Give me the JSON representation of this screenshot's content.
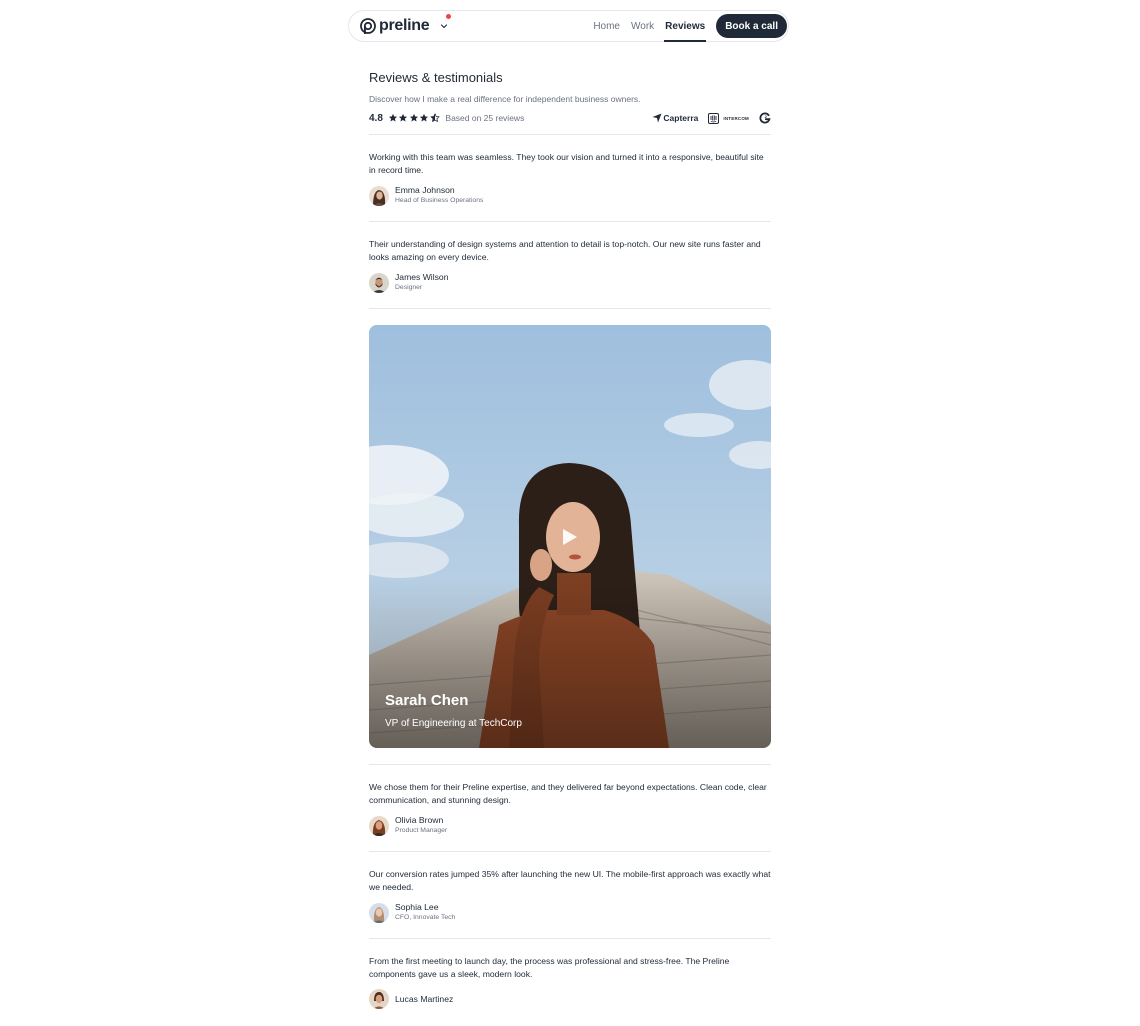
{
  "header": {
    "brand_name": "preline",
    "nav": [
      {
        "label": "Home",
        "active": false
      },
      {
        "label": "Work",
        "active": false
      },
      {
        "label": "Reviews",
        "active": true
      }
    ],
    "cta_label": "Book a call",
    "icons": {
      "logo": "preline-logo-icon",
      "chevron": "chevron-down-icon",
      "notification": "notification-dot"
    }
  },
  "section": {
    "title": "Reviews & testimonials",
    "subtitle": "Discover how I make a real difference for independent business owners.",
    "rating_value": "4.8",
    "stars_full": 4,
    "stars_half": 1,
    "rating_text": "Based on 25 reviews",
    "partners": [
      {
        "name": "Capterra",
        "icon": "capterra-icon"
      },
      {
        "name": "INTERCOM",
        "icon": "intercom-icon"
      },
      {
        "name": "G2",
        "icon": "g2-icon"
      }
    ]
  },
  "reviews_before": [
    {
      "quote": "Working with this team was seamless. They took our vision and turned it into a responsive, beautiful site in record time.",
      "name": "Emma Johnson",
      "role": "Head of Business Operations"
    },
    {
      "quote": "Their understanding of design systems and attention to detail is top-notch. Our new site runs faster and looks amazing on every device.",
      "name": "James Wilson",
      "role": "Designer"
    }
  ],
  "video": {
    "name": "Sarah Chen",
    "role": "VP of Engineering at TechCorp",
    "icon": "play-icon"
  },
  "reviews_after": [
    {
      "quote": "We chose them for their Preline expertise, and they delivered far beyond expectations. Clean code, clear communication, and stunning design.",
      "name": "Olivia Brown",
      "role": "Product Manager"
    },
    {
      "quote": "Our conversion rates jumped 35% after launching the new UI. The mobile-first approach was exactly what we needed.",
      "name": "Sophia Lee",
      "role": "CFO, Innovate Tech"
    },
    {
      "quote": "From the first meeting to launch day, the process was professional and stress-free. The Preline components gave us a sleek, modern look.",
      "name": "Lucas Martinez",
      "role": ""
    }
  ],
  "colors": {
    "text": "#1f2937",
    "muted": "#6b7280",
    "border": "#e5e7eb",
    "dark_button": "#1f2937",
    "notification": "#ef4444",
    "sky": "#a8c4e0",
    "sweater": "#8a4526"
  }
}
